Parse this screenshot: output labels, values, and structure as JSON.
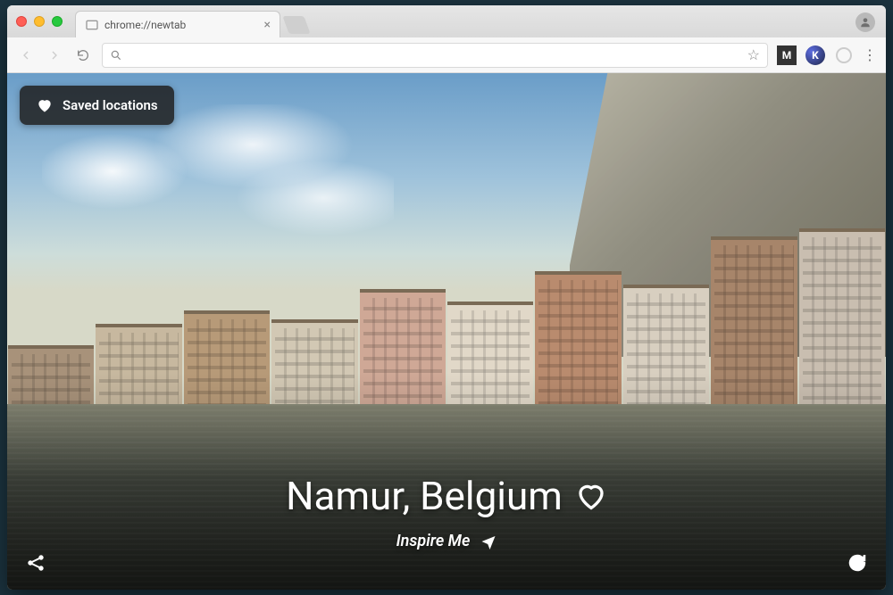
{
  "browser": {
    "tab_title": "chrome://newtab",
    "address_value": "",
    "address_placeholder": ""
  },
  "overlay": {
    "saved_locations_label": "Saved locations",
    "location_title": "Namur, Belgium",
    "inspire_label": "Inspire Me"
  },
  "icons": {
    "heart": "heart-icon",
    "heart_outline": "heart-outline-icon",
    "plane": "plane-icon",
    "share": "share-icon",
    "refresh": "refresh-icon",
    "star": "star-icon",
    "search": "search-icon",
    "back": "chevron-left-icon",
    "forward": "chevron-right-icon",
    "reload": "reload-icon",
    "close": "close-icon",
    "menu": "menu-dots-icon",
    "avatar": "avatar-icon"
  }
}
